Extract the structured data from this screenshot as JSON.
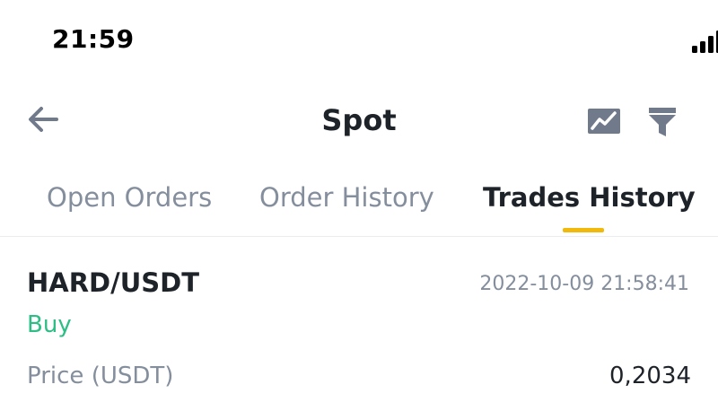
{
  "status_bar": {
    "time": "21:59"
  },
  "header": {
    "title": "Spot",
    "icons": {
      "back": "back-arrow-icon",
      "chart": "chart-icon",
      "filter": "filter-icon"
    }
  },
  "tabs": [
    {
      "label": "Open Orders",
      "active": false
    },
    {
      "label": "Order History",
      "active": false
    },
    {
      "label": "Trades History",
      "active": true
    }
  ],
  "trade": {
    "pair": "HARD/USDT",
    "timestamp": "2022-10-09 21:58:41",
    "side": "Buy",
    "price_label": "Price (USDT)",
    "price_value": "0,2034"
  },
  "colors": {
    "accent": "#f0b90b",
    "buy": "#2ebd85",
    "muted": "#848e9c",
    "text": "#1e2329",
    "battery_low": "#f6465d"
  }
}
